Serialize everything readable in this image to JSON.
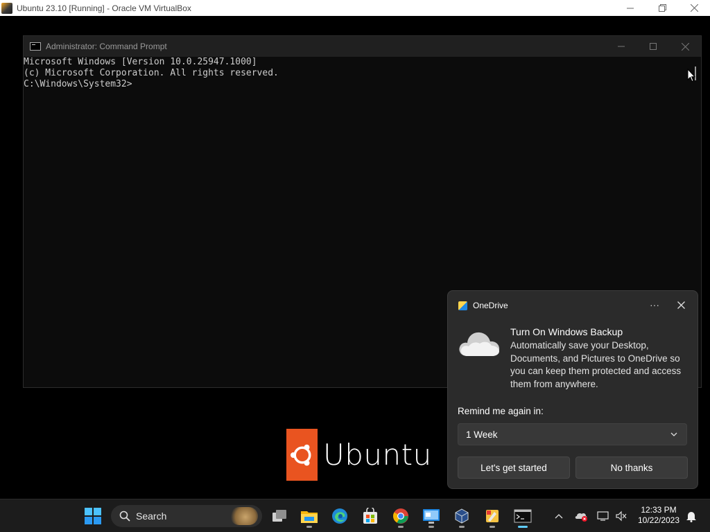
{
  "host": {
    "title": "Ubuntu 23.10 [Running] - Oracle VM VirtualBox"
  },
  "cmd": {
    "title": "Administrator: Command Prompt",
    "lines": [
      "Microsoft Windows [Version 10.0.25947.1000]",
      "(c) Microsoft Corporation. All rights reserved.",
      "",
      "C:\\Windows\\System32>"
    ]
  },
  "splash": {
    "wordmark": "Ubuntu"
  },
  "toast": {
    "app_name": "OneDrive",
    "more_label": "···",
    "title": "Turn On Windows Backup",
    "message": "Automatically save your Desktop, Documents, and Pictures to OneDrive so you can keep them protected and access them from anywhere.",
    "remind_label": "Remind me again in:",
    "remind_value": "1 Week",
    "primary_button": "Let's get started",
    "secondary_button": "No thanks"
  },
  "taskbar": {
    "search_label": "Search",
    "clock_time": "12:33 PM",
    "clock_date": "10/22/2023",
    "apps": [
      "start",
      "search",
      "task-view",
      "file-explorer",
      "edge",
      "store",
      "chrome",
      "remote-desktop",
      "virtualbox",
      "paint",
      "terminal"
    ]
  },
  "colors": {
    "ubuntu_orange": "#e95420",
    "terminal_text": "#cccccc",
    "toast_bg": "#2b2b2b",
    "taskbar_bg": "#1c1c1c"
  }
}
